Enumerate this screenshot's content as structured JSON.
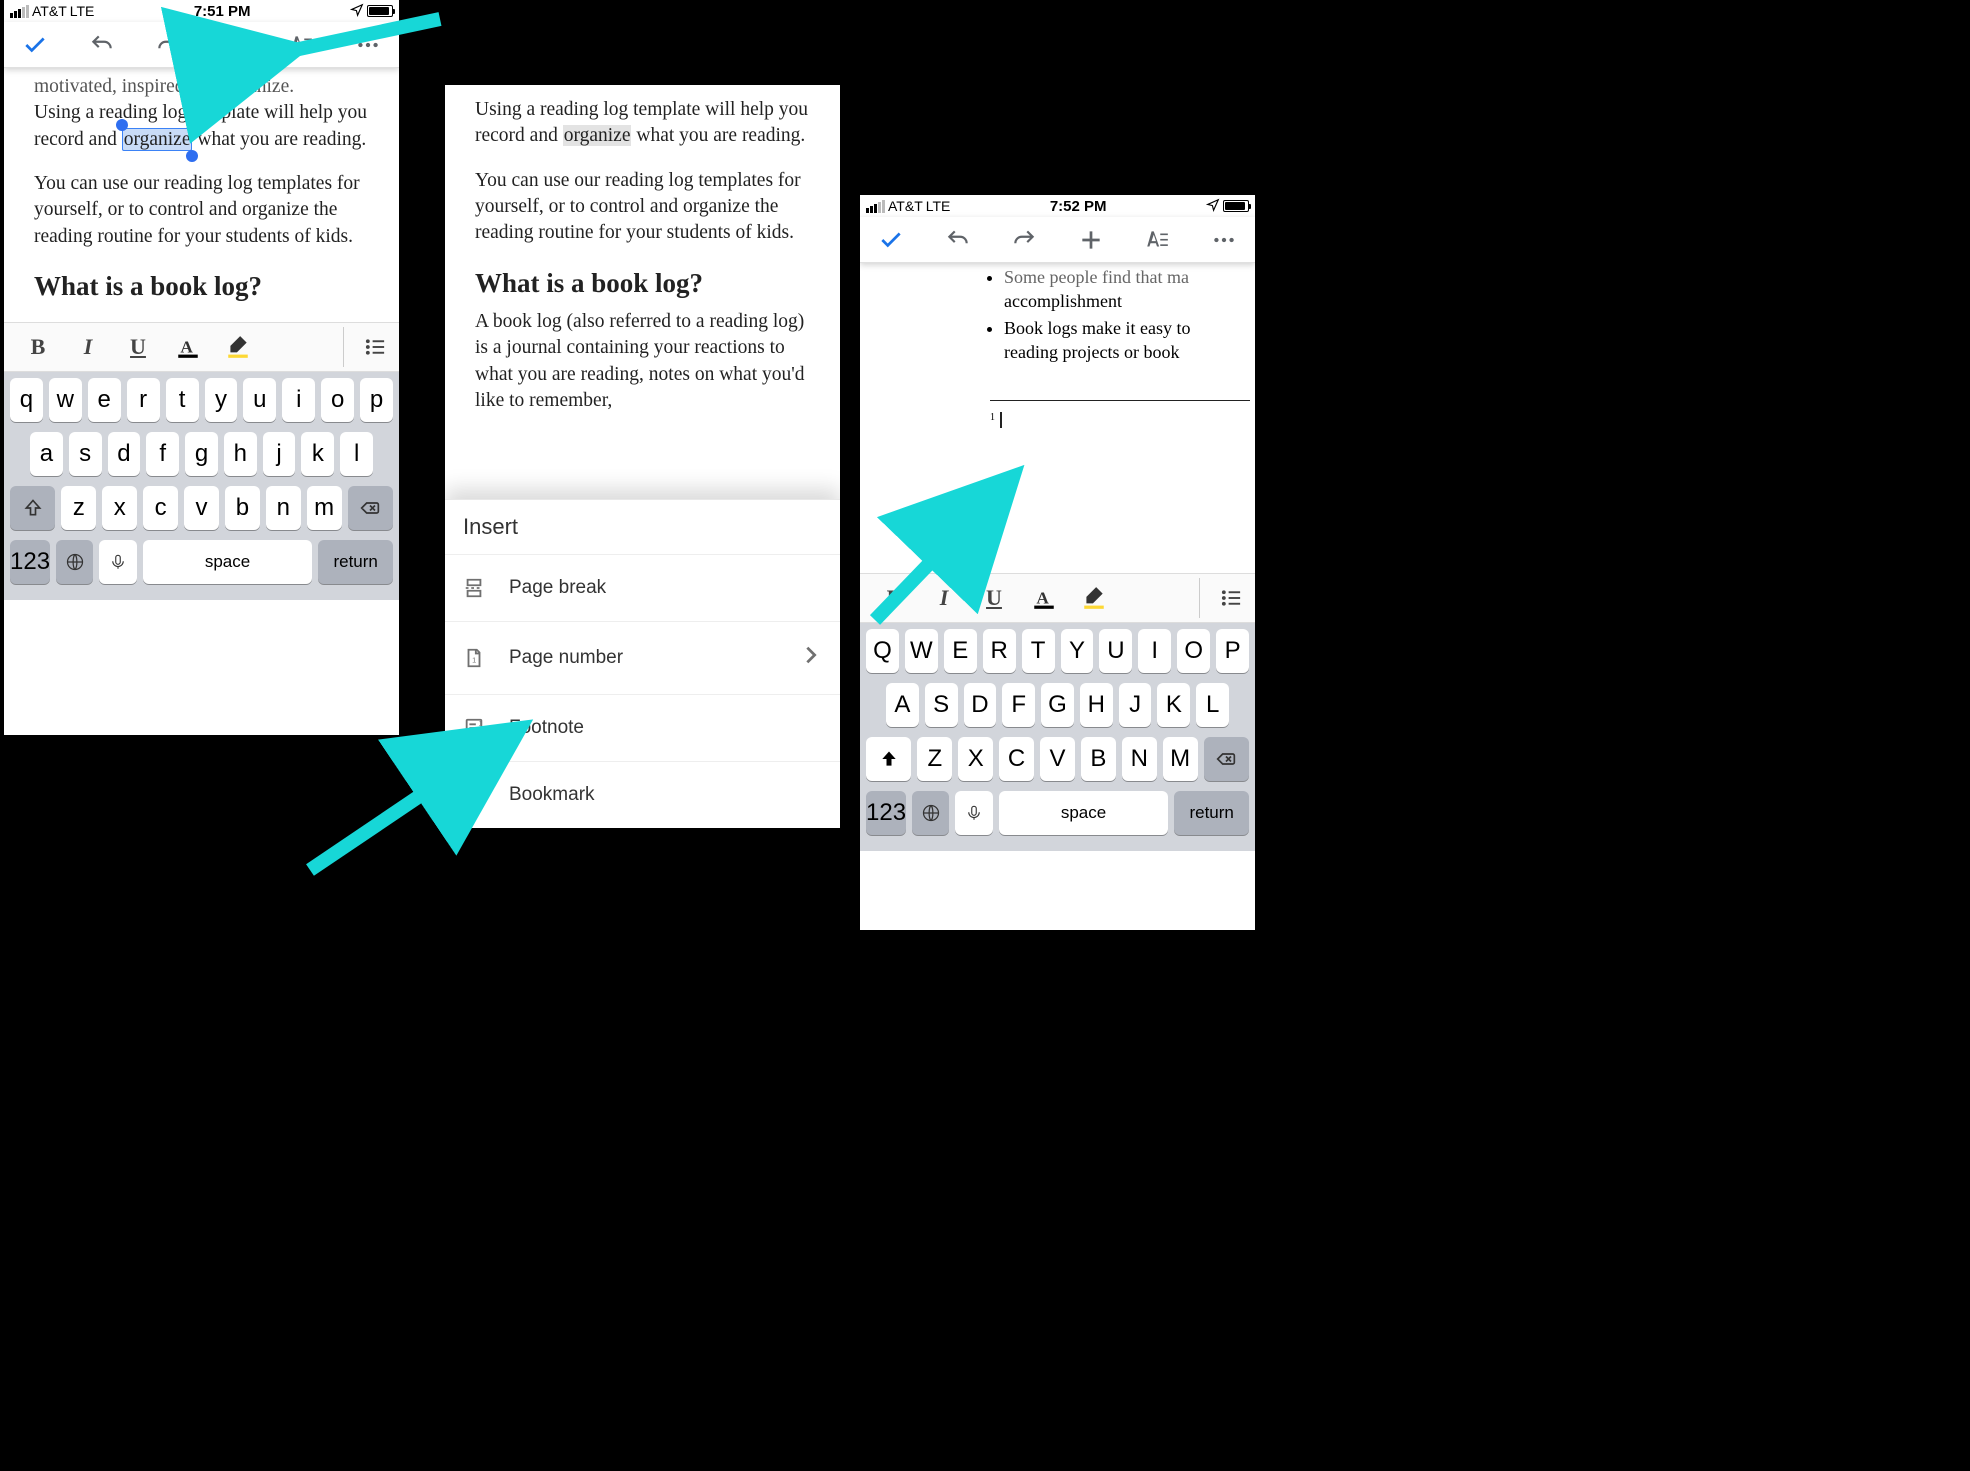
{
  "phone1": {
    "status": {
      "carrier": "AT&T",
      "net": "LTE",
      "time": "7:51 PM"
    },
    "doc": {
      "line0_cut": "motivated, inspired and organize.",
      "p1a": "Using a reading log template will help you record and ",
      "sel": "organize",
      "p1b": " what you are reading.",
      "p2": "You can use our reading log templates for yourself, or to control and organize the reading routine for your students of kids.",
      "h2": "What is a book log?"
    },
    "fmt": {
      "bold": "B",
      "italic": "I",
      "underline": "U"
    },
    "kbd": {
      "r1": [
        "q",
        "w",
        "e",
        "r",
        "t",
        "y",
        "u",
        "i",
        "o",
        "p"
      ],
      "r2": [
        "a",
        "s",
        "d",
        "f",
        "g",
        "h",
        "j",
        "k",
        "l"
      ],
      "r3": [
        "z",
        "x",
        "c",
        "v",
        "b",
        "n",
        "m"
      ],
      "num": "123",
      "space": "space",
      "return": "return"
    }
  },
  "phone2": {
    "doc": {
      "p1a": "Using a reading log template will help you record and ",
      "gray": "organize",
      "p1b": " what you are reading.",
      "p2": "You can use our reading log templates for yourself, or to control and organize the reading routine for your students of kids.",
      "h2": "What is a book log?",
      "p3": "A book log (also referred to a reading log) is a journal containing your reactions to what you are reading, notes on what you'd like to remember,"
    },
    "menu": {
      "title": "Insert",
      "items": [
        {
          "label": "Page break",
          "icon": "page-break"
        },
        {
          "label": "Page number",
          "icon": "page-number",
          "chevron": true
        },
        {
          "label": "Footnote",
          "icon": "footnote"
        },
        {
          "label": "Bookmark",
          "icon": "bookmark"
        }
      ]
    }
  },
  "phone3": {
    "status": {
      "carrier": "AT&T",
      "net": "LTE",
      "time": "7:52 PM"
    },
    "doc": {
      "li1a": "Some people find that ma",
      "li1b": "accomplishment",
      "li2a": "Book logs make it easy to",
      "li2b": "reading projects or book ",
      "fn_num": "1"
    },
    "fmt": {
      "bold": "B",
      "italic": "I",
      "underline": "U"
    },
    "kbd": {
      "r1": [
        "Q",
        "W",
        "E",
        "R",
        "T",
        "Y",
        "U",
        "I",
        "O",
        "P"
      ],
      "r2": [
        "A",
        "S",
        "D",
        "F",
        "G",
        "H",
        "J",
        "K",
        "L"
      ],
      "r3": [
        "Z",
        "X",
        "C",
        "V",
        "B",
        "N",
        "M"
      ],
      "num": "123",
      "space": "space",
      "return": "return"
    }
  }
}
